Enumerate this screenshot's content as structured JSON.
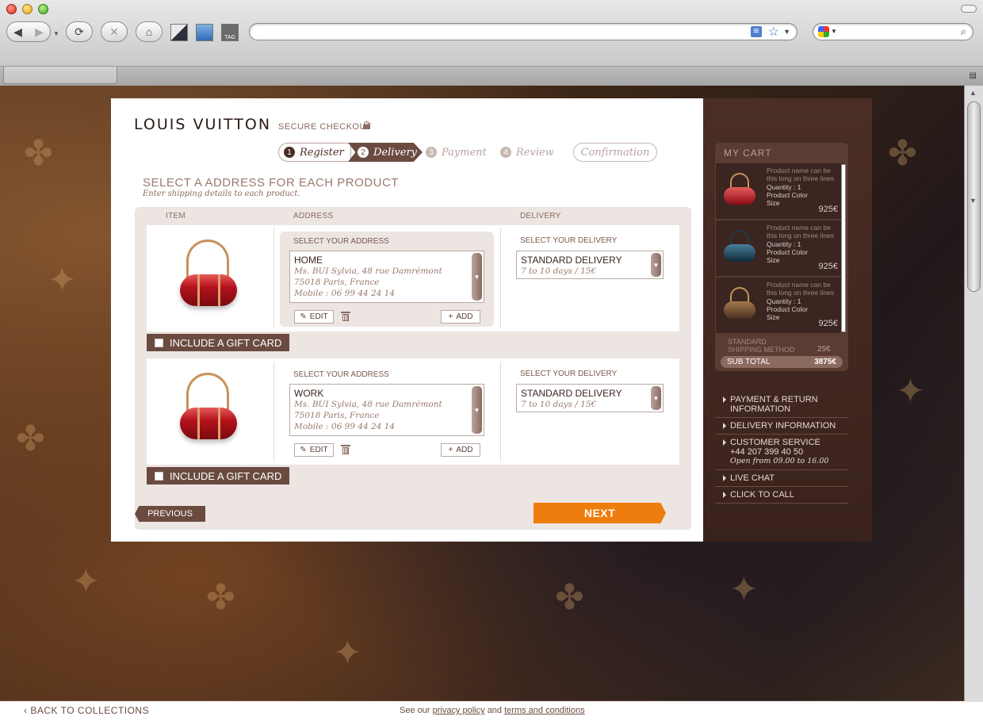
{
  "browser": {
    "tab_menu_icon": "tab-overflow-icon"
  },
  "header": {
    "logo": "LOUIS VUITTON",
    "secure_checkout": "SECURE CHECKOUT"
  },
  "steps": [
    {
      "num": "1",
      "label": "Register",
      "state": "done"
    },
    {
      "num": "2",
      "label": "Delivery",
      "state": "active"
    },
    {
      "num": "3",
      "label": "Payment",
      "state": "pending"
    },
    {
      "num": "4",
      "label": "Review",
      "state": "pending"
    },
    {
      "num": "",
      "label": "Confirmation",
      "state": "pending"
    }
  ],
  "main": {
    "title": "SELECT A ADDRESS FOR EACH PRODUCT",
    "subtitle": "Enter shipping details to each product.",
    "columns": {
      "item": "ITEM",
      "address": "ADDRESS",
      "delivery": "DELIVERY"
    },
    "rows": [
      {
        "address_label": "SELECT YOUR ADDRESS",
        "address_name": "HOME",
        "address_lines": [
          "Ms. BUI Sylvia, 48 rue Damrémont",
          "75018 Paris, France",
          "Mobile : 06 99 44 24 14"
        ],
        "edit": "EDIT",
        "add": "ADD",
        "delivery_label": "SELECT YOUR DELIVERY",
        "delivery_name": "STANDARD DELIVERY",
        "delivery_detail": "7 to 10 days / 15€",
        "gift": "INCLUDE A GIFT CARD"
      },
      {
        "address_label": "SELECT YOUR ADDRESS",
        "address_name": "WORK",
        "address_lines": [
          "Ms. BUI Sylvia, 48 rue Damrémont",
          "75018 Paris, France",
          "Mobile : 06 99 44 24 14"
        ],
        "edit": "EDIT",
        "add": "ADD",
        "delivery_label": "SELECT YOUR DELIVERY",
        "delivery_name": "STANDARD DELIVERY",
        "delivery_detail": "7 to 10 days / 15€",
        "gift": "INCLUDE A GIFT CARD"
      }
    ],
    "previous": "PREVIOUS",
    "next": "NEXT"
  },
  "cart": {
    "title": "MY CART",
    "items": [
      {
        "desc": "Product name can be this long on three lines",
        "qty": "Quantity : 1",
        "color": "Product Color",
        "size": "Size",
        "price": "925€"
      },
      {
        "desc": "Product name can be this long on three lines",
        "qty": "Quantity : 1",
        "color": "Product Color",
        "size": "Size",
        "price": "925€"
      },
      {
        "desc": "Product name can be this long on three lines",
        "qty": "Quantity : 1",
        "color": "Product Color",
        "size": "Size",
        "price": "925€"
      }
    ],
    "shipping_label_1": "STANDARD",
    "shipping_label_2": "SHIPPING METHOD",
    "shipping_cost": "25€",
    "subtotal_label": "SUB TOTAL",
    "subtotal_value": "3875€"
  },
  "links": {
    "payment_return_1": "PAYMENT & RETURN",
    "payment_return_2": "INFORMATION",
    "delivery_info": "DELIVERY INFORMATION",
    "customer_service": "CUSTOMER SERVICE",
    "phone": "+44 207 399 40 50",
    "hours": "Open from 09.00 to 16.00",
    "live_chat": "LIVE CHAT",
    "click_to_call": "CLICK TO CALL"
  },
  "footer": {
    "back": "BACK TO COLLECTIONS",
    "see_our": "See our",
    "privacy": "privacy policy",
    "and": "and",
    "terms": "terms and conditions"
  },
  "colors": {
    "accent_brown": "#6b4b40",
    "next_orange": "#ef7d0d"
  }
}
